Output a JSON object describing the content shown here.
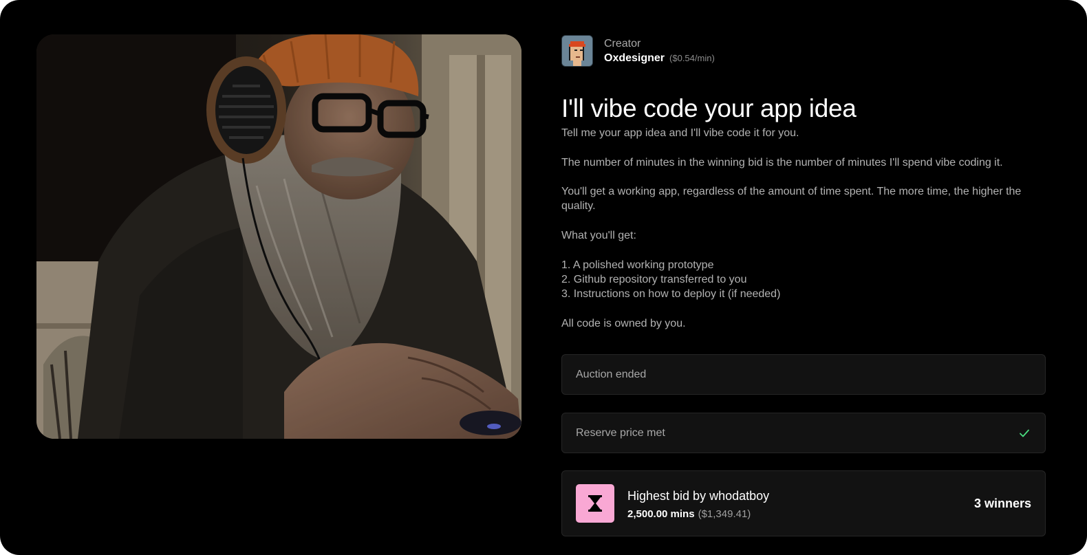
{
  "creator": {
    "label": "Creator",
    "name": "Oxdesigner",
    "rate": "($0.54/min)",
    "avatar_icon": "pixel-punk-avatar"
  },
  "listing": {
    "title": "I'll vibe code your app idea",
    "paragraphs": [
      "Tell me your app idea and I'll vibe code it for you.",
      "The number of minutes in the winning bid is the number of minutes I'll spend vibe coding it.",
      "You'll get a working app, regardless of the amount of time spent. The more time, the higher the quality.",
      "What you'll get:"
    ],
    "deliverables": [
      "1. A polished working prototype",
      "2. Github repository transferred to you",
      "3. Instructions on how to deploy it (if needed)"
    ],
    "ownership": "All code is owned by you."
  },
  "status": {
    "auction": "Auction ended",
    "reserve": "Reserve price met",
    "reserve_icon": "check-icon"
  },
  "bid": {
    "icon": "hourglass-icon",
    "title": "Highest bid by whodatboy",
    "amount": "2,500.00 mins",
    "usd": "($1,349.41)",
    "winners": "3 winners"
  },
  "colors": {
    "background": "#000000",
    "panel": "#121212",
    "accent_pink": "#f9a8d4",
    "check_green": "#4ade80",
    "beanie_orange": "#c96a2c"
  }
}
